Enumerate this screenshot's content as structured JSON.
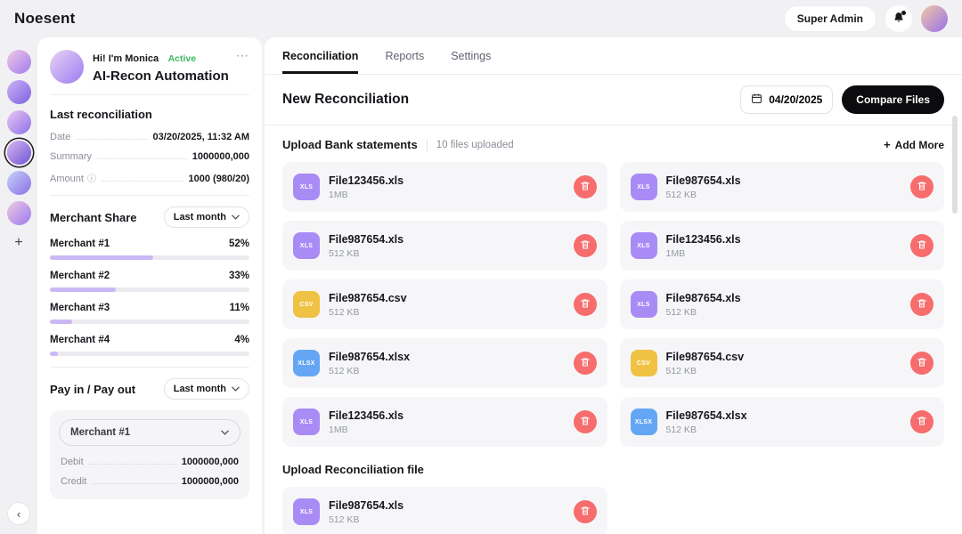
{
  "topbar": {
    "brand": "Noesent",
    "super_admin_label": "Super Admin"
  },
  "icons": {
    "more": "⋯",
    "plus": "+",
    "chevron_left": "‹",
    "info": "ⓘ"
  },
  "colors": {
    "xls": "#a98bf6",
    "csv": "#f0c243",
    "xlsx": "#64a6f4",
    "danger": "#f76c6c",
    "progress": "#c9b8f5",
    "active_green": "#3bb95e"
  },
  "rail": {
    "avatars": [
      {
        "selected": false,
        "colors": [
          "#f3c7e3",
          "#9f7df0"
        ]
      },
      {
        "selected": false,
        "colors": [
          "#cdb4f5",
          "#7e5fe0"
        ]
      },
      {
        "selected": false,
        "colors": [
          "#e8c9f2",
          "#8f6fe8"
        ]
      },
      {
        "selected": true,
        "colors": [
          "#d9b6f0",
          "#6f55d6"
        ]
      },
      {
        "selected": false,
        "colors": [
          "#c7d2f7",
          "#8a6fe8"
        ]
      },
      {
        "selected": false,
        "colors": [
          "#f0c9e0",
          "#9a7af0"
        ]
      }
    ]
  },
  "sidebar": {
    "greeting": "Hi! I'm Monica",
    "status": "Active",
    "title": "AI-Recon Automation",
    "last_reconciliation": {
      "heading": "Last reconciliation",
      "rows": [
        {
          "label": "Date",
          "value": "03/20/2025, 11:32 AM"
        },
        {
          "label": "Summary",
          "value": "1000000,000"
        },
        {
          "label": "Amount",
          "value": "1000 (980/20)",
          "info": true
        }
      ]
    },
    "merchant_share": {
      "heading": "Merchant Share",
      "filter": "Last month",
      "merchants": [
        {
          "name": "Merchant #1",
          "percent": "52%",
          "value": 52
        },
        {
          "name": "Merchant #2",
          "percent": "33%",
          "value": 33
        },
        {
          "name": "Merchant #3",
          "percent": "11%",
          "value": 11
        },
        {
          "name": "Merchant #4",
          "percent": "4%",
          "value": 4
        }
      ]
    },
    "pay": {
      "heading": "Pay in / Pay out",
      "filter": "Last month",
      "merchant_select": "Merchant #1",
      "rows": [
        {
          "label": "Debit",
          "value": "1000000,000"
        },
        {
          "label": "Credit",
          "value": "1000000,000"
        }
      ]
    }
  },
  "main": {
    "tabs": [
      {
        "label": "Reconciliation",
        "active": true
      },
      {
        "label": "Reports",
        "active": false
      },
      {
        "label": "Settings",
        "active": false
      }
    ],
    "heading": "New Reconciliation",
    "date": "04/20/2025",
    "compare_button": "Compare Files",
    "bank_section": {
      "heading": "Upload Bank statements",
      "count_label": "10 files uploaded",
      "add_more": "Add More",
      "files": [
        {
          "name": "File123456.xls",
          "size": "1MB",
          "type": "xls"
        },
        {
          "name": "File987654.xls",
          "size": "512 KB",
          "type": "xls"
        },
        {
          "name": "File987654.xls",
          "size": "512 KB",
          "type": "xls"
        },
        {
          "name": "File123456.xls",
          "size": "1MB",
          "type": "xls"
        },
        {
          "name": "File987654.csv",
          "size": "512 KB",
          "type": "csv"
        },
        {
          "name": "File987654.xls",
          "size": "512 KB",
          "type": "xls"
        },
        {
          "name": "File987654.xlsx",
          "size": "512 KB",
          "type": "xlsx"
        },
        {
          "name": "File987654.csv",
          "size": "512 KB",
          "type": "csv"
        },
        {
          "name": "File123456.xls",
          "size": "1MB",
          "type": "xls"
        },
        {
          "name": "File987654.xlsx",
          "size": "512 KB",
          "type": "xlsx"
        }
      ]
    },
    "recon_section": {
      "heading": "Upload Reconciliation file",
      "files": [
        {
          "name": "File987654.xls",
          "size": "512 KB",
          "type": "xls"
        }
      ]
    }
  }
}
